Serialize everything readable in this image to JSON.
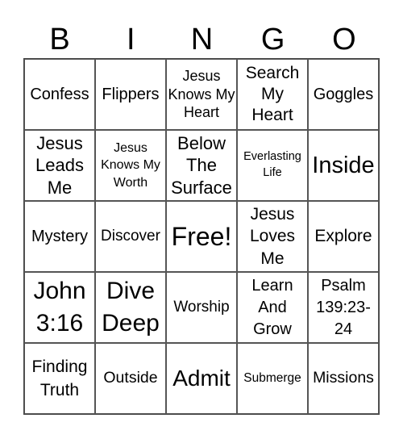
{
  "header": {
    "letters": [
      "B",
      "I",
      "N",
      "G",
      "O"
    ]
  },
  "board": {
    "cells": [
      "Confess",
      "Flippers",
      "Jesus Knows My Heart",
      "Search My Heart",
      "Goggles",
      "Jesus Leads Me",
      "Jesus Knows My Worth",
      "Below The Surface",
      "Everlasting Life",
      "Inside",
      "Mystery",
      "Discover",
      "Free!",
      "Jesus Loves Me",
      "Explore",
      "John 3:16",
      "Dive Deep",
      "Worship",
      "Learn And Grow",
      "Psalm 139:23-24",
      "Finding Truth",
      "Outside",
      "Admit",
      "Submerge",
      "Missions"
    ]
  }
}
